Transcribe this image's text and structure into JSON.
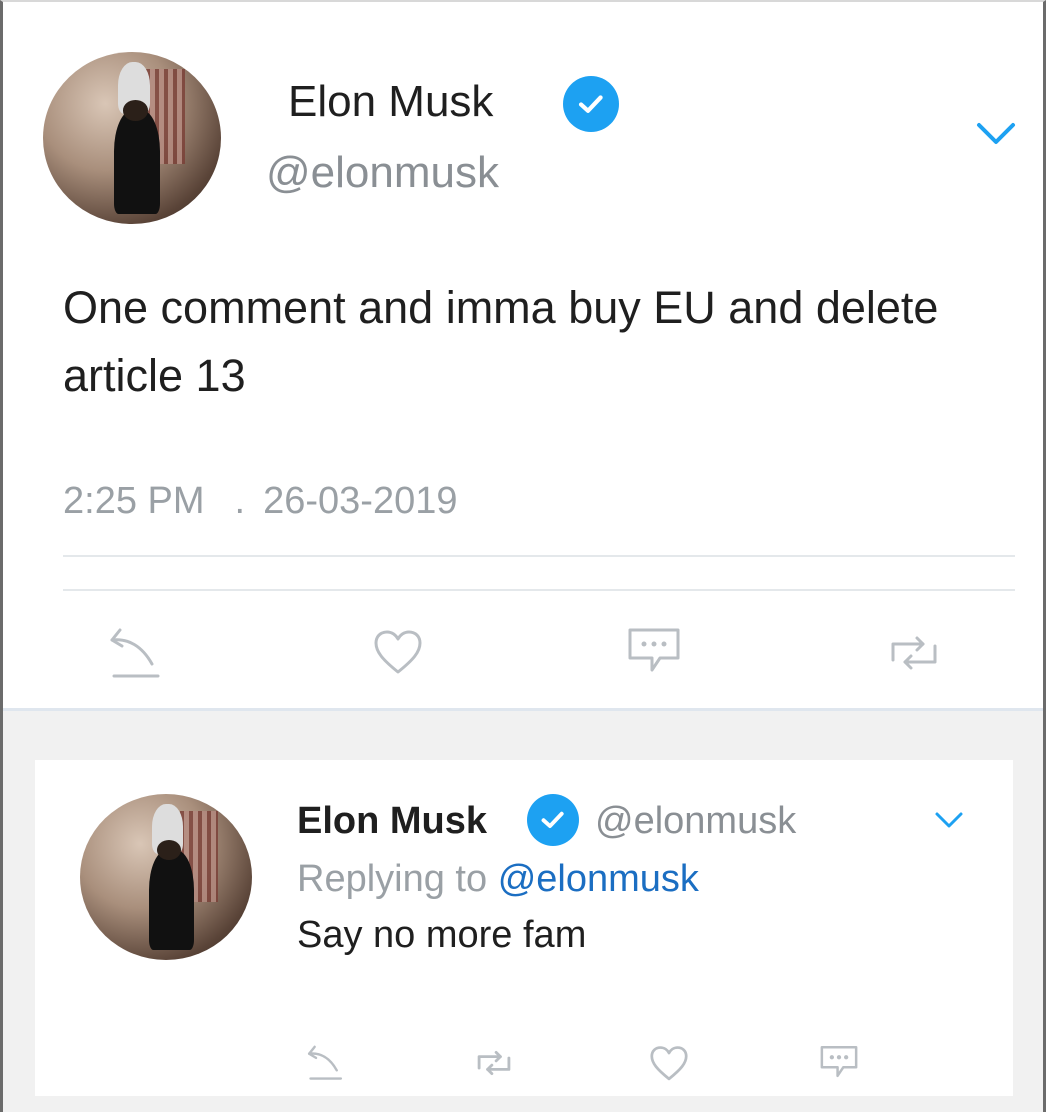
{
  "main_tweet": {
    "author_name": "Elon Musk",
    "author_handle": "@elonmusk",
    "verified_icon": "verified-badge-icon",
    "menu_icon": "chevron-down-icon",
    "text": "One comment and imma buy EU and delete article 13",
    "time": "2:25 PM",
    "separator": ".",
    "date": "26-03-2019",
    "actions": [
      "reply-icon",
      "like-icon",
      "comment-icon",
      "retweet-icon"
    ]
  },
  "reply_tweet": {
    "author_name": "Elon Musk",
    "author_handle": "@elonmusk",
    "replying_prefix": "Replying to",
    "replying_to": "@elonmusk",
    "text": "Say no more fam",
    "actions": [
      "reply-icon",
      "retweet-icon",
      "like-icon",
      "comment-icon"
    ]
  },
  "colors": {
    "accent": "#1da1f2",
    "mention": "#1b6ec2",
    "muted_text": "#9aa0a5",
    "icon_gray": "#b9bec3"
  }
}
